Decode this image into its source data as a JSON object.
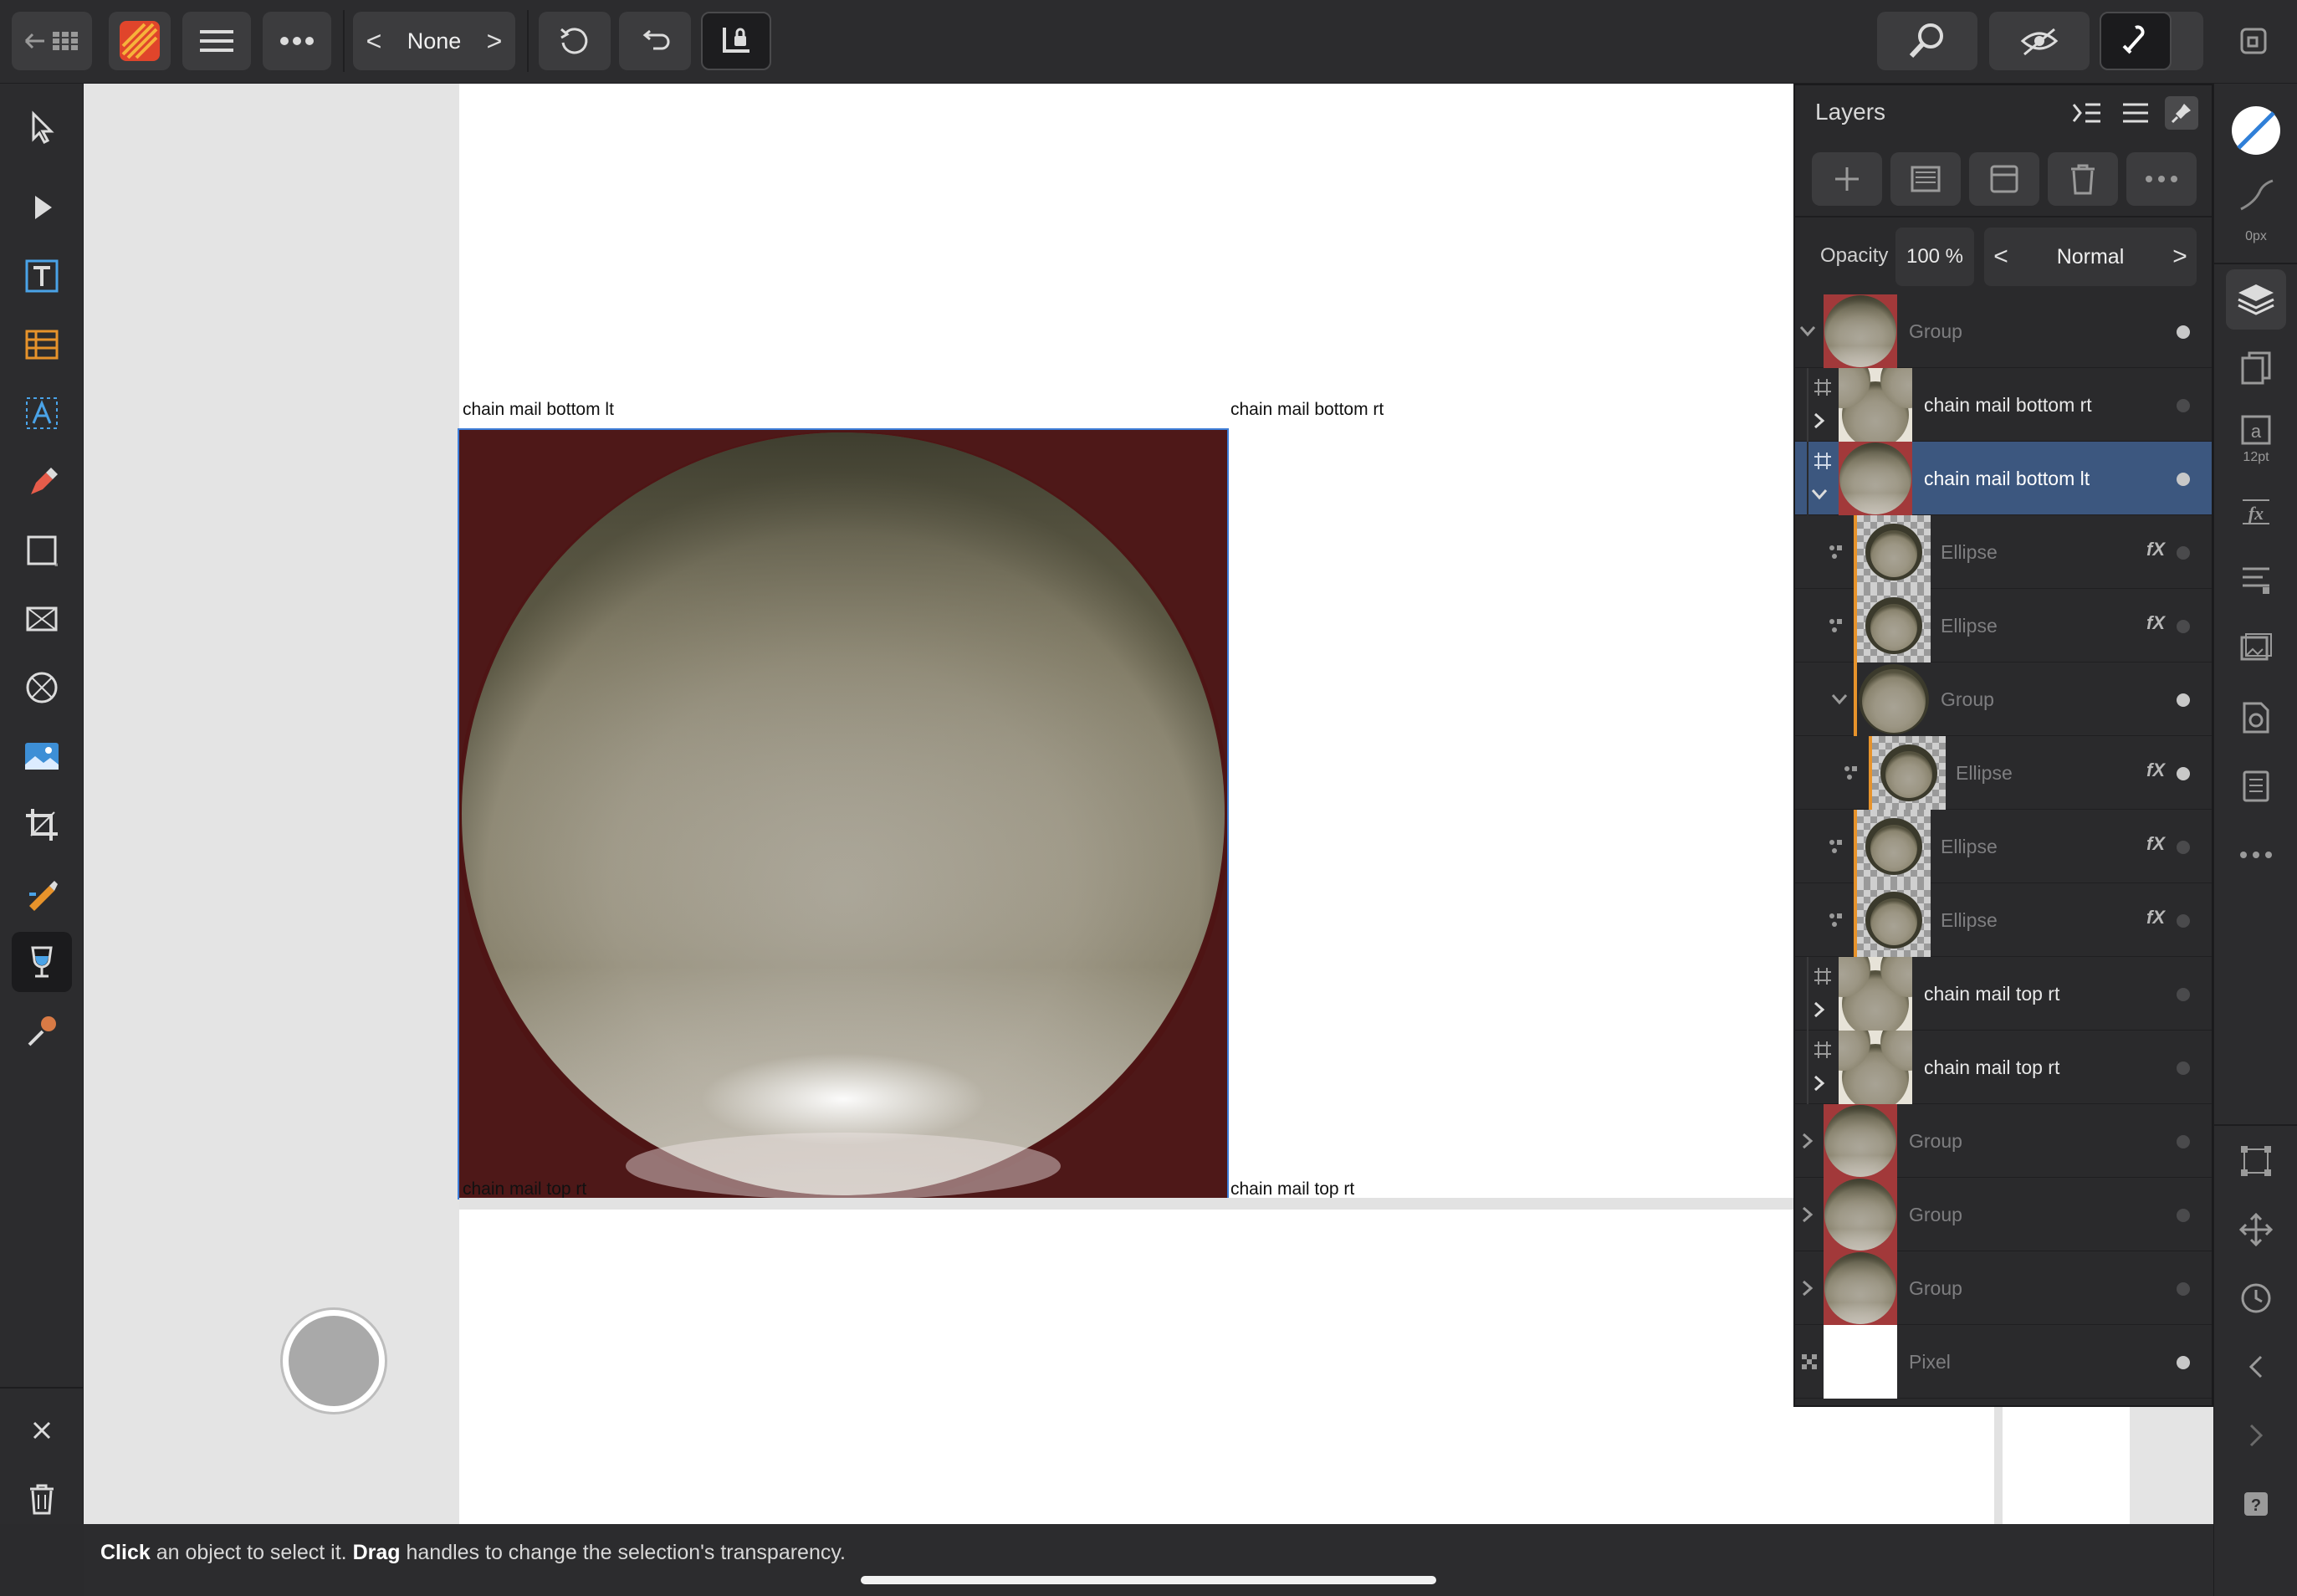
{
  "toolbar": {
    "doc_nav_label": "None",
    "prev_symbol": "<",
    "next_symbol": ">"
  },
  "canvas": {
    "label_top_left": "chain mail bottom lt",
    "label_top_right": "chain mail bottom rt",
    "label_bottom_left": "chain mail top rt",
    "label_bottom_right": "chain mail top rt",
    "artboard_fill": "#a2393a",
    "selection_color": "#3e7ed8"
  },
  "status": {
    "click_word": "Click",
    "click_rest": " an object to select it. ",
    "drag_word": "Drag",
    "drag_rest": " handles to change the selection's transparency."
  },
  "right_strip": {
    "stroke_width_label": "0px",
    "font_size_label": "12pt"
  },
  "layers_panel": {
    "title": "Layers",
    "opacity_label": "Opacity",
    "opacity_value": "100 %",
    "blend_mode": "Normal",
    "fx_label": "fX",
    "layers": [
      {
        "name": "Group",
        "selected": false,
        "visible_dot": true
      },
      {
        "name": "chain mail bottom rt",
        "selected": false,
        "visible_dot": false
      },
      {
        "name": "chain mail bottom lt",
        "selected": true,
        "visible_dot": true
      },
      {
        "name": "Ellipse",
        "selected": false,
        "visible_dot": false
      },
      {
        "name": "Ellipse",
        "selected": false,
        "visible_dot": false
      },
      {
        "name": "Group",
        "selected": false,
        "visible_dot": true
      },
      {
        "name": "Ellipse",
        "selected": false,
        "visible_dot": true
      },
      {
        "name": "Ellipse",
        "selected": false,
        "visible_dot": false
      },
      {
        "name": "Ellipse",
        "selected": false,
        "visible_dot": false
      },
      {
        "name": "chain mail top rt",
        "selected": false,
        "visible_dot": false
      },
      {
        "name": "chain mail top rt",
        "selected": false,
        "visible_dot": false
      },
      {
        "name": "Group",
        "selected": false,
        "visible_dot": false
      },
      {
        "name": "Group",
        "selected": false,
        "visible_dot": false
      },
      {
        "name": "Group",
        "selected": false,
        "visible_dot": false
      },
      {
        "name": "Pixel",
        "selected": false,
        "visible_dot": true
      }
    ]
  },
  "icons": {
    "app": "affinity-designer-icon",
    "back": "back-to-documents-icon",
    "menu": "hamburger-menu-icon",
    "more": "more-options-icon",
    "undo": "undo-icon",
    "history": "history-icon",
    "lock": "lock-icon",
    "zoom": "zoom-icon",
    "view": "view-mode-icon",
    "snapping": "snapping-icon",
    "window": "window-mode-icon"
  }
}
